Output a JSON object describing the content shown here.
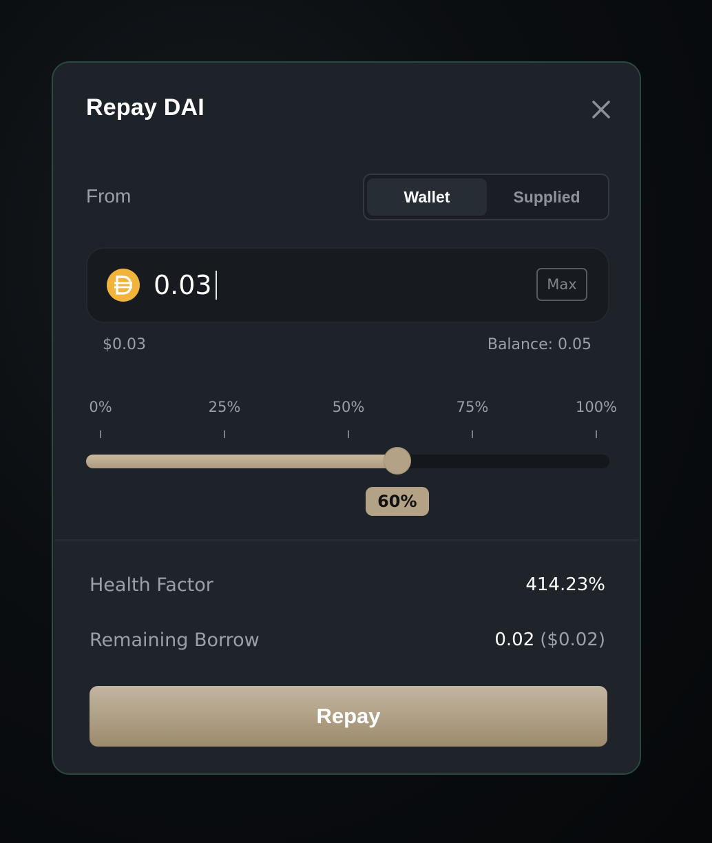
{
  "modal": {
    "title": "Repay DAI"
  },
  "from": {
    "label": "From",
    "options": [
      "Wallet",
      "Supplied"
    ],
    "selected": "Wallet"
  },
  "amount": {
    "value": "0.03",
    "token_icon": "dai-icon",
    "max_label": "Max",
    "usd_value": "$0.03",
    "balance": "Balance: 0.05"
  },
  "slider": {
    "tick_labels": [
      "0%",
      "25%",
      "50%",
      "75%",
      "100%"
    ],
    "value_percent": 60,
    "badge": "60%"
  },
  "details": {
    "health_factor_label": "Health Factor",
    "health_factor_value": "414.23%",
    "remaining_borrow_label": "Remaining Borrow",
    "remaining_borrow_value": "0.02",
    "remaining_borrow_usd": "($0.02)"
  },
  "action": {
    "label": "Repay"
  },
  "colors": {
    "accent": "#b3a286",
    "dai": "#f5ac37",
    "border": "#2b4842",
    "panel": "#1e232a"
  }
}
